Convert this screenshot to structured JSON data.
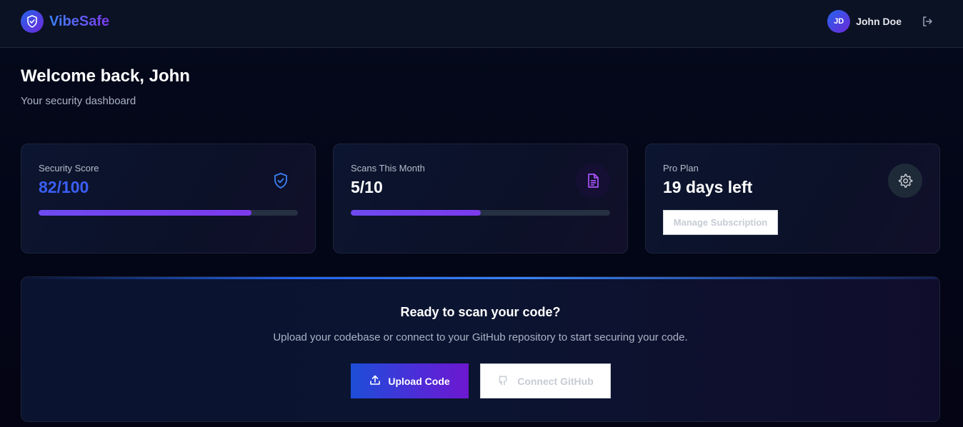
{
  "header": {
    "brand_name": "VibeSafe",
    "user": {
      "initials": "JD",
      "name": "John Doe"
    }
  },
  "page": {
    "title": "Welcome back, John",
    "subtitle": "Your security dashboard"
  },
  "stats": {
    "security_score": {
      "label": "Security Score",
      "value": "82/100",
      "progress": 0.82,
      "icon": "shield-check-icon",
      "value_color": "#3b5ff5"
    },
    "scans": {
      "label": "Scans This Month",
      "value": "5/10",
      "progress": 0.5,
      "icon": "document-icon"
    },
    "plan": {
      "label": "Pro Plan",
      "value": "19 days left",
      "button_label": "Manage Subscription",
      "icon": "gear-icon"
    }
  },
  "scan_panel": {
    "title": "Ready to scan your code?",
    "description": "Upload your codebase or connect to your GitHub repository to start securing your code.",
    "upload_label": "Upload Code",
    "github_label": "Connect GitHub"
  },
  "colors": {
    "accent_blue": "#2563eb",
    "accent_purple": "#7c3aed",
    "background": "#030712"
  }
}
